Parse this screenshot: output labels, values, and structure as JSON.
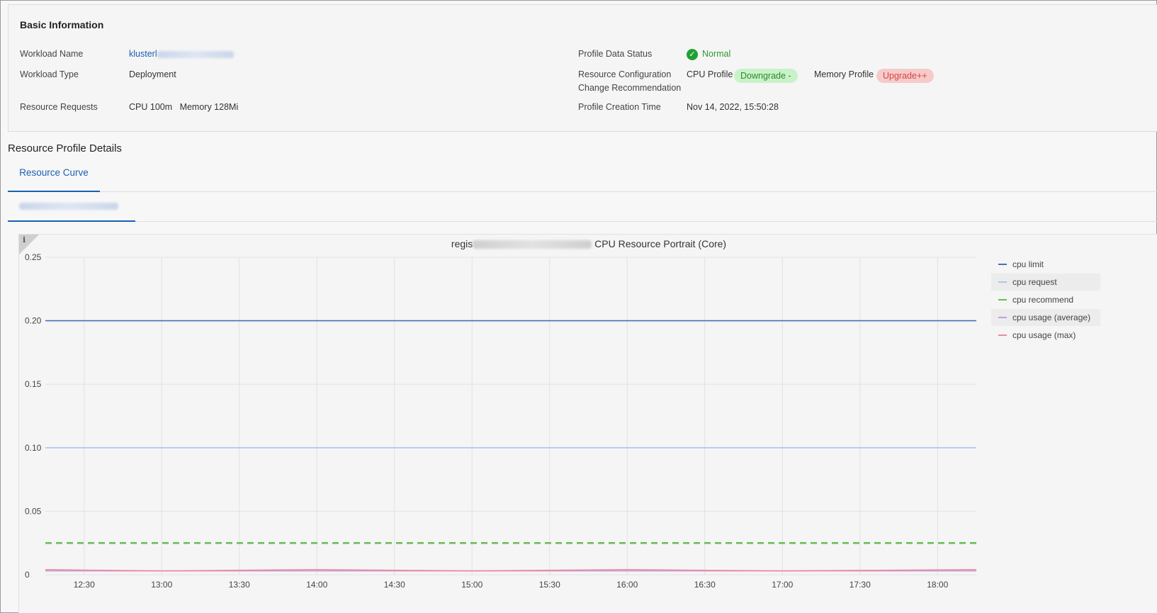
{
  "basic_info": {
    "title": "Basic Information",
    "workload_name_label": "Workload Name",
    "workload_name_value": "klusterl",
    "workload_type_label": "Workload Type",
    "workload_type_value": "Deployment",
    "resource_requests_label": "Resource Requests",
    "resource_requests_cpu": "CPU 100m",
    "resource_requests_memory": "Memory 128Mi",
    "profile_status_label": "Profile Data Status",
    "profile_status_value": "Normal",
    "recommendation_label_line1": "Resource Configuration",
    "recommendation_label_line2": "Change Recommendation",
    "cpu_profile_label": "CPU Profile",
    "cpu_profile_badge": "Downgrade -",
    "memory_profile_label": "Memory Profile",
    "memory_profile_badge": "Upgrade++",
    "creation_time_label": "Profile Creation Time",
    "creation_time_value": "Nov 14, 2022, 15:50:28"
  },
  "details": {
    "title": "Resource Profile Details",
    "tab_label": "Resource Curve"
  },
  "chart_title": {
    "prefix": "regis",
    "suffix": "CPU Resource Portrait (Core)"
  },
  "colors": {
    "cpu_limit": "#4a6fb5",
    "cpu_request": "#a9c6ee",
    "cpu_recommend": "#66bb55",
    "cpu_usage_avg": "#c59be0",
    "cpu_usage_max": "#ee8a9a",
    "link": "#1a5fb4"
  },
  "chart_data": {
    "type": "line",
    "title": "",
    "xlabel": "",
    "ylabel": "",
    "x_ticks": [
      "12:30",
      "13:00",
      "13:30",
      "14:00",
      "14:30",
      "15:00",
      "15:30",
      "16:00",
      "16:30",
      "17:00",
      "17:30",
      "18:00"
    ],
    "y_ticks": [
      "0",
      "0.05",
      "0.10",
      "0.15",
      "0.20",
      "0.25"
    ],
    "ylim": [
      0,
      0.25
    ],
    "xlim": [
      "12:15",
      "18:15"
    ],
    "grid": true,
    "legend_position": "right",
    "series": [
      {
        "name": "cpu limit",
        "style": "solid",
        "x": [
          "12:15",
          "18:15"
        ],
        "values": [
          0.2,
          0.2
        ]
      },
      {
        "name": "cpu request",
        "style": "solid",
        "x": [
          "12:15",
          "18:15"
        ],
        "values": [
          0.1,
          0.1
        ]
      },
      {
        "name": "cpu recommend",
        "style": "dashed",
        "x": [
          "12:15",
          "18:15"
        ],
        "values": [
          0.025,
          0.025
        ]
      },
      {
        "name": "cpu usage (average)",
        "style": "solid",
        "x": [
          "12:15",
          "13:00",
          "14:00",
          "15:00",
          "16:00",
          "17:00",
          "18:15"
        ],
        "values": [
          0.003,
          0.003,
          0.003,
          0.003,
          0.003,
          0.003,
          0.003
        ]
      },
      {
        "name": "cpu usage (max)",
        "style": "solid",
        "x": [
          "12:15",
          "13:00",
          "14:00",
          "15:00",
          "16:00",
          "17:00",
          "18:15"
        ],
        "values": [
          0.004,
          0.003,
          0.004,
          0.003,
          0.004,
          0.003,
          0.004
        ]
      }
    ]
  }
}
